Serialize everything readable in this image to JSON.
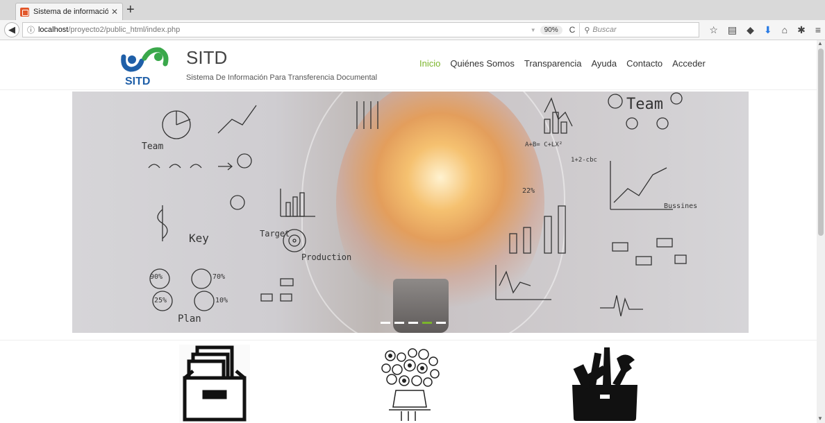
{
  "browser": {
    "tab_title": "Sistema de información par",
    "tab_close": "✕",
    "new_tab": "+",
    "url_host": "localhost",
    "url_path": "/proyecto2/public_html/index.php",
    "zoom": "90%",
    "search_placeholder": "Buscar"
  },
  "site": {
    "brand_title": "SITD",
    "brand_subtitle": "Sistema De Información Para Transferencia Documental",
    "logo_text": "SITD"
  },
  "menu": {
    "items": [
      "Inicio",
      "Quiénes Somos",
      "Transparencia",
      "Ayuda",
      "Contacto",
      "Acceder"
    ],
    "active": "Inicio"
  },
  "hero": {
    "doodles": [
      "Team",
      "Team",
      "Key",
      "Target",
      "Production",
      "Plan",
      "Bussines",
      "90%",
      "70%",
      "25%",
      "10%",
      "A+B= C+LX²",
      "1+2-cbc",
      "22%"
    ],
    "slides": 5,
    "active_slide": 4
  },
  "colors": {
    "accent": "#7bb52b",
    "logo_blue": "#1f5fa8",
    "logo_green": "#3aa84b"
  }
}
